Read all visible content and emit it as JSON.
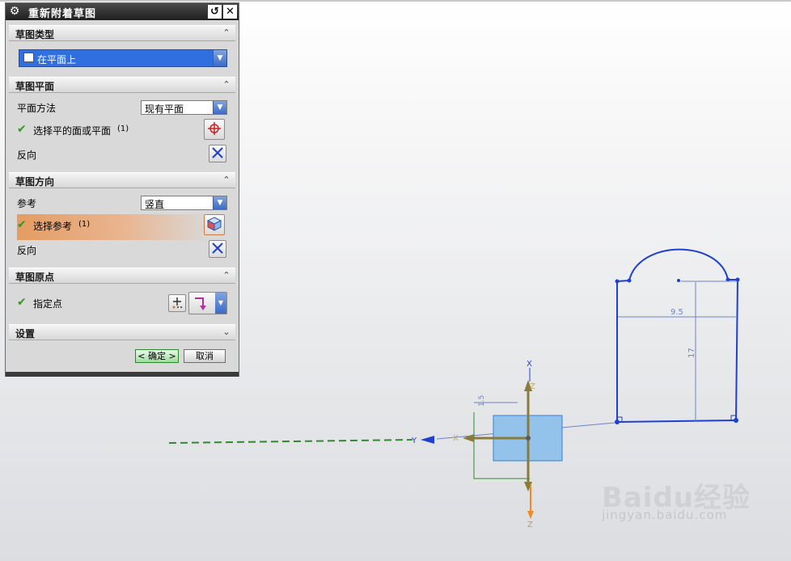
{
  "dialog": {
    "title": "重新附着草图",
    "sections": {
      "sketch_type": {
        "header": "草图类型",
        "value": "在平面上"
      },
      "sketch_plane": {
        "header": "草图平面",
        "plane_method_label": "平面方法",
        "plane_method_value": "现有平面",
        "select_face_label": "选择平的面或平面",
        "select_face_count": "(1)",
        "reverse_label": "反向"
      },
      "sketch_orientation": {
        "header": "草图方向",
        "reference_label": "参考",
        "reference_value": "竖直",
        "select_reference_label": "选择参考",
        "select_reference_count": "(1)",
        "reverse_label": "反向"
      },
      "sketch_origin": {
        "header": "草图原点",
        "specify_point_label": "指定点"
      },
      "settings": {
        "header": "设置"
      }
    },
    "buttons": {
      "ok": "< 确定 >",
      "cancel": "取消"
    }
  },
  "viewport": {
    "axis_labels": {
      "x": "X",
      "y": "Y",
      "z": "Z"
    },
    "dimension_width": "9.5",
    "dimension_height": "17",
    "dimension_small": "1.5",
    "colors": {
      "sketch": "#1f3fd0",
      "dimension": "#6a84c8",
      "plane": "#93c3ea",
      "axis_y": "#2e8b2e",
      "axis_z_neg": "#f08a24"
    }
  },
  "watermark": {
    "brand": "Baidu经验",
    "url": "jingyan.baidu.com"
  }
}
